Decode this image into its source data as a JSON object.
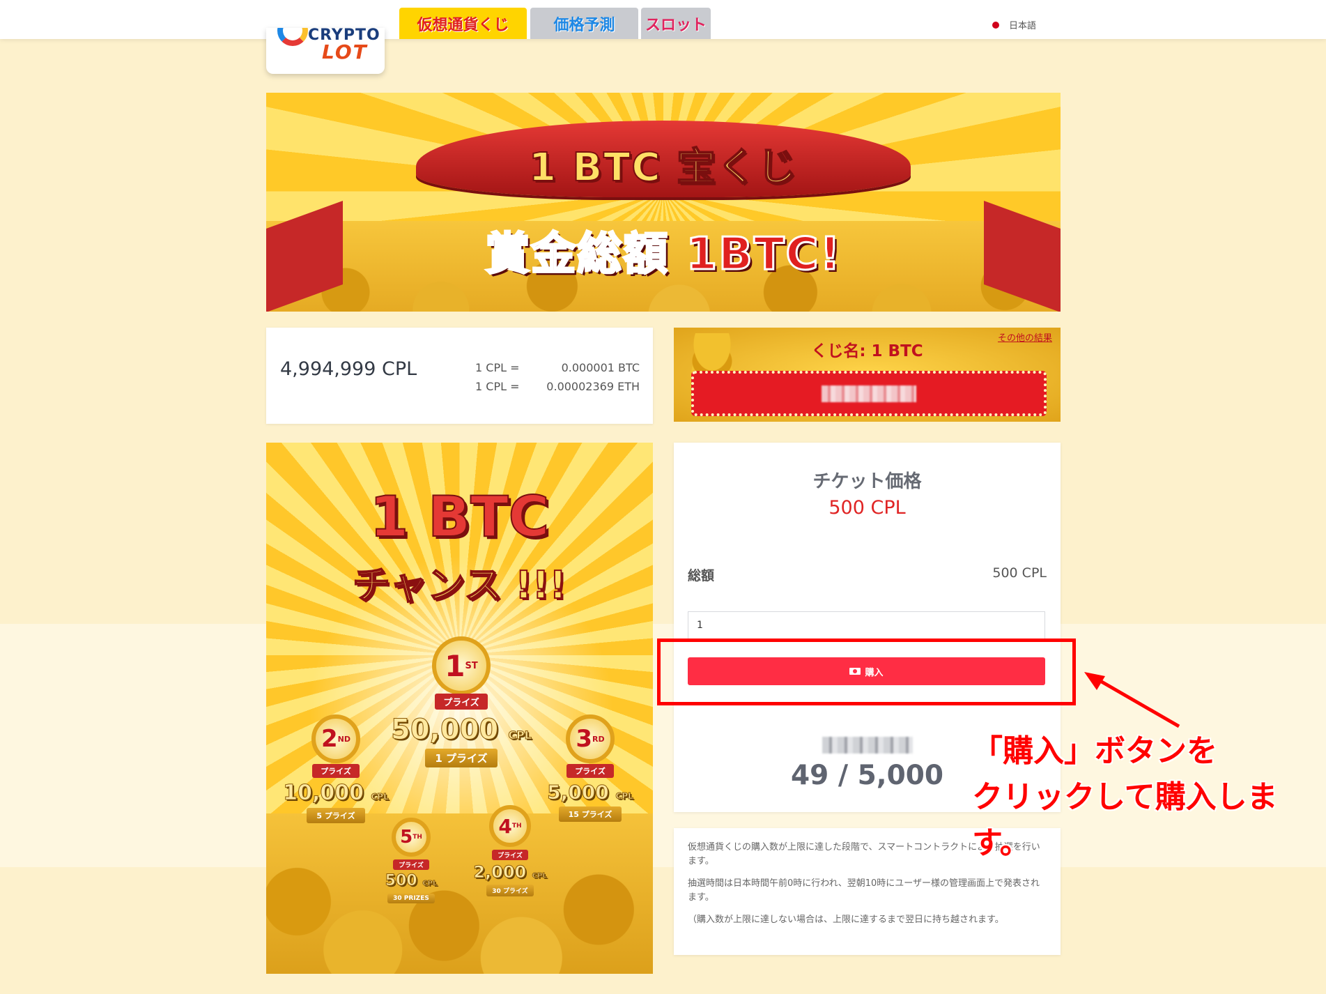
{
  "header": {
    "logo_top": "CRYPTO",
    "logo_bottom": "LOT",
    "tabs": [
      {
        "label": "仮想通貨くじ",
        "active": true
      },
      {
        "label": "価格予測",
        "active": false
      },
      {
        "label": "スロット",
        "active": false
      }
    ],
    "language": "日本語"
  },
  "hero": {
    "title": "1 BTC 宝くじ",
    "subtitle": "賞金総額 1BTC!"
  },
  "balance": {
    "value": "4,994,999 CPL",
    "rates": [
      {
        "label": "1 CPL =",
        "value": "0.000001 BTC"
      },
      {
        "label": "1 CPL =",
        "value": "0.00002369 ETH"
      }
    ]
  },
  "lottery": {
    "name": "くじ名: 1 BTC",
    "other_results": "その他の結果"
  },
  "poster": {
    "title": "1 BTC",
    "subtitle": "チャンス !!!",
    "prizes": [
      {
        "rank": "1",
        "suffix": "ST",
        "ribbon": "プライズ",
        "amount": "50,000",
        "unit": "CPL",
        "count": "1 プライズ"
      },
      {
        "rank": "2",
        "suffix": "ND",
        "ribbon": "プライズ",
        "amount": "10,000",
        "unit": "CPL",
        "count": "5 プライズ"
      },
      {
        "rank": "3",
        "suffix": "RD",
        "ribbon": "プライズ",
        "amount": "5,000",
        "unit": "CPL",
        "count": "15 プライズ"
      },
      {
        "rank": "5",
        "suffix": "TH",
        "ribbon": "プライズ",
        "amount": "500",
        "unit": "CPL",
        "count": "30 PRIZES"
      },
      {
        "rank": "4",
        "suffix": "TH",
        "ribbon": "プライズ",
        "amount": "2,000",
        "unit": "CPL",
        "count": "30 プライズ"
      }
    ]
  },
  "ticket": {
    "title": "チケット価格",
    "price": "500 CPL",
    "total_label": "総額",
    "total_value": "500 CPL",
    "quantity": "1",
    "buy_label": "購入",
    "sold_count": "49 / 5,000"
  },
  "info": {
    "p1": "仮想通貨くじの購入数が上限に達した段階で、スマートコントラクトによる抽選を行います。",
    "p2": "抽選時間は日本時間午前0時に行われ、翌朝10時にユーザー様の管理画面上で発表されます。",
    "p3": "（購入数が上限に達しない場合は、上限に達するまで翌日に持ち越されます。"
  },
  "annotation": {
    "line1": "「購入」ボタンを",
    "line2": "クリックして購入します。"
  },
  "colors": {
    "accent_red": "#ff2d44",
    "annotation_red": "#ff0000",
    "background": "#fdf1cc"
  }
}
